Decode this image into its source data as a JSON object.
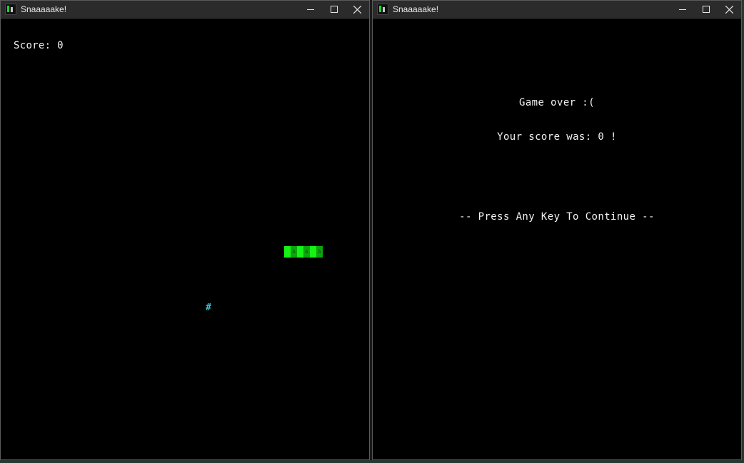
{
  "windows": [
    {
      "title": "Snaaaaake!",
      "score_text": "Score: 0",
      "food_glyph": "#",
      "snake_glyph": "A"
    },
    {
      "title": "Snaaaaake!",
      "game_over": "Game over :(",
      "your_score": "Your score was: 0 !",
      "press_key": "-- Press Any Key To Continue --"
    }
  ],
  "colors": {
    "snake_light": "#15f214",
    "snake_dark": "#0ba60c",
    "food": "#29c7d8",
    "background": "#000000"
  },
  "icons": {
    "app": "snake-app-icon",
    "minimize": "minimize-icon",
    "maximize": "maximize-icon",
    "close": "close-icon"
  }
}
